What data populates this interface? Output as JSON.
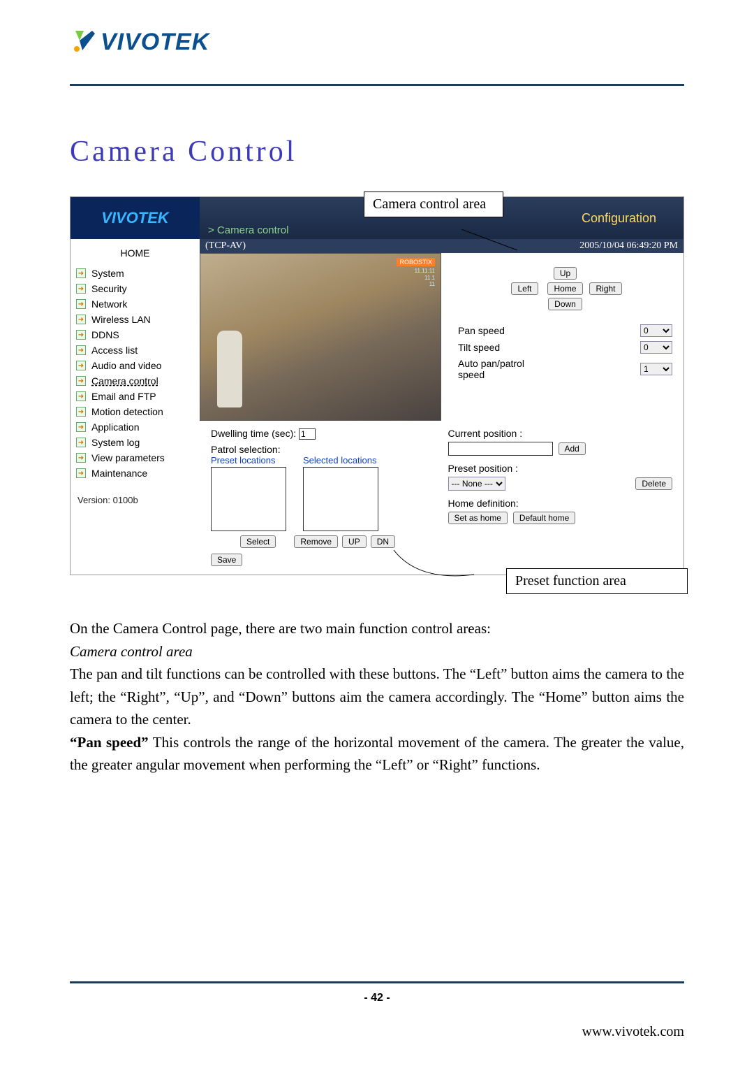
{
  "page": {
    "brand": "VIVOTEK",
    "section_title": "Camera Control",
    "page_number": "- 42 -",
    "website": "www.vivotek.com"
  },
  "callouts": {
    "control_area": "Camera control area",
    "preset_area": "Preset function area"
  },
  "shot": {
    "brand": "VIVOTEK",
    "breadcrumb": "> Camera control",
    "config_link": "Configuration",
    "protocol": "(TCP-AV)",
    "timestamp": "2005/10/04 06:49:20 PM",
    "home_link": "HOME",
    "nav": [
      "System",
      "Security",
      "Network",
      "Wireless LAN",
      "DDNS",
      "Access list",
      "Audio and video",
      "Camera control",
      "Email and FTP",
      "Motion detection",
      "Application",
      "System log",
      "View parameters",
      "Maintenance"
    ],
    "nav_active_index": 7,
    "version": "Version: 0100b",
    "dpad": {
      "up": "Up",
      "left": "Left",
      "home": "Home",
      "right": "Right",
      "down": "Down"
    },
    "speeds": {
      "pan_label": "Pan speed",
      "pan_value": "0",
      "tilt_label": "Tilt speed",
      "tilt_value": "0",
      "auto_label": "Auto pan/patrol speed",
      "auto_value": "1"
    },
    "preset": {
      "dwell_label": "Dwelling time (sec):",
      "dwell_value": "1",
      "patrol_label": "Patrol selection:",
      "col_preset": "Preset locations",
      "col_selected": "Selected locations",
      "select_btn": "Select",
      "remove_btn": "Remove",
      "up_btn": "UP",
      "dn_btn": "DN",
      "save_btn": "Save",
      "curpos_label": "Current position :",
      "add_btn": "Add",
      "presetpos_label": "Preset position :",
      "preset_dropdown": "--- None ---",
      "delete_btn": "Delete",
      "homedef_label": "Home definition:",
      "set_home_btn": "Set as home",
      "default_home_btn": "Default home"
    }
  },
  "text": {
    "line1": "On the Camera Control page, there are two main function control areas:",
    "sub1": "Camera control area",
    "p1": "The pan and tilt functions can be controlled with these buttons. The “Left” button aims the camera to the left; the “Right”, “Up”, and “Down” buttons aim the camera accordingly. The “Home” button aims the camera to the center.",
    "p2a": "“Pan speed”",
    "p2b": " This controls the range of the horizontal movement of the camera. The greater the value, the greater angular movement when performing the “Left” or “Right” functions."
  }
}
